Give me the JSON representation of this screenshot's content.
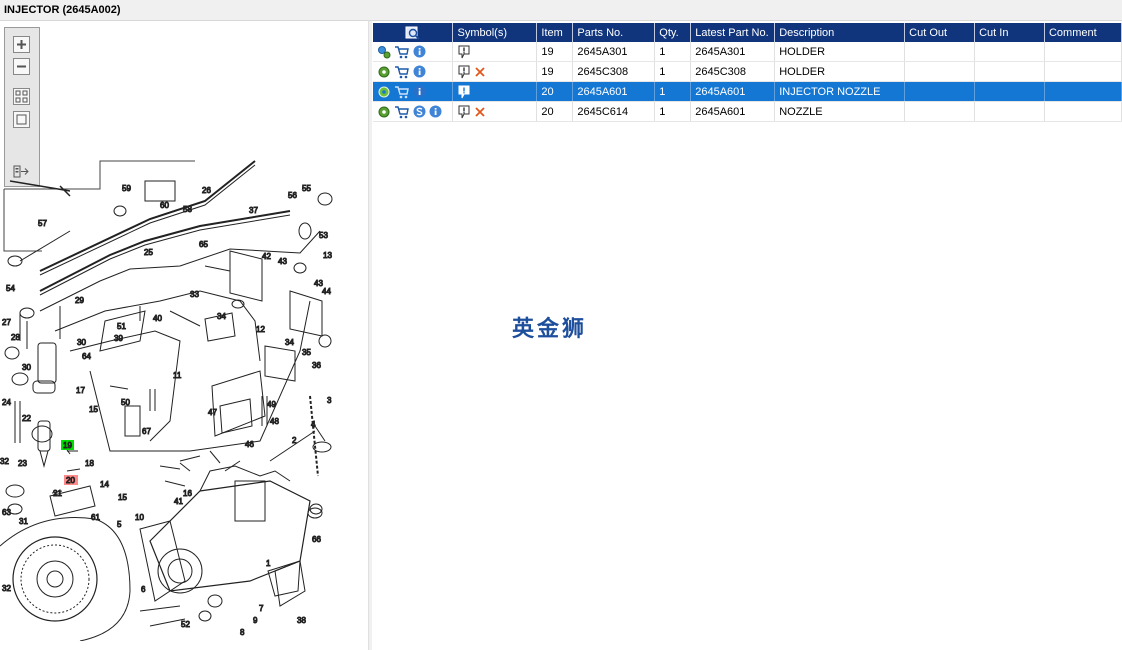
{
  "window": {
    "title": "INJECTOR (2645A002)"
  },
  "table": {
    "columns": [
      "Symbol(s)",
      "Item",
      "Parts No.",
      "Qty.",
      "Latest Part No.",
      "Description",
      "Cut Out",
      "Cut In",
      "Comment"
    ],
    "rows": [
      {
        "item": "19",
        "parts_no": "2645A301",
        "qty": "1",
        "latest": "2645A301",
        "description": "HOLDER",
        "cut_out": "",
        "cut_in": "",
        "comment": ""
      },
      {
        "item": "19",
        "parts_no": "2645C308",
        "qty": "1",
        "latest": "2645C308",
        "description": "HOLDER",
        "cut_out": "",
        "cut_in": "",
        "comment": ""
      },
      {
        "item": "20",
        "parts_no": "2645A601",
        "qty": "1",
        "latest": "2645A601",
        "description": "INJECTOR NOZZLE",
        "cut_out": "",
        "cut_in": "",
        "comment": ""
      },
      {
        "item": "20",
        "parts_no": "2645C614",
        "qty": "1",
        "latest": "2645A601",
        "description": "NOZZLE",
        "cut_out": "",
        "cut_in": "",
        "comment": ""
      }
    ]
  },
  "watermark": "英金狮",
  "diagram": {
    "labels": {
      "l59": "59",
      "l60": "60",
      "l58": "58",
      "l26": "26",
      "l55": "55",
      "l56": "56",
      "l37": "37",
      "l57": "57",
      "l65": "65",
      "l53": "53",
      "l42": "42",
      "l43a": "43",
      "l13": "13",
      "l25": "25",
      "l43b": "43",
      "l44": "44",
      "l54": "54",
      "l29": "29",
      "l33": "33",
      "l27": "27",
      "l51": "51",
      "l40": "40",
      "l34a": "34",
      "l12": "12",
      "l28": "28",
      "l30a": "30",
      "l39": "39",
      "l64": "64",
      "l11": "11",
      "l34b": "34",
      "l35": "35",
      "l30b": "30",
      "l36": "36",
      "l24": "24",
      "l17": "17",
      "l15a": "15",
      "l50": "50",
      "l49": "49",
      "l3": "3",
      "l22": "22",
      "l67": "67",
      "l47": "47",
      "l48": "48",
      "l19": "19",
      "l4": "4",
      "l2": "2",
      "l46": "46",
      "l32a": "32",
      "l23": "23",
      "l18": "18",
      "l14": "14",
      "l20": "20",
      "l21": "21",
      "l15b": "15",
      "l16": "16",
      "l63": "63",
      "l41": "41",
      "l61": "61",
      "l10": "10",
      "l31": "31",
      "l5": "5",
      "l66": "66",
      "l1": "1",
      "l6": "6",
      "l32b": "32",
      "l7": "7",
      "l52": "52",
      "l9": "9",
      "l38": "38",
      "l8": "8"
    }
  },
  "colors": {
    "header_bg": "#10357d",
    "selected_row": "#1477d4",
    "highlight_green": "#00dd00",
    "highlight_red": "#ff8a8a"
  }
}
